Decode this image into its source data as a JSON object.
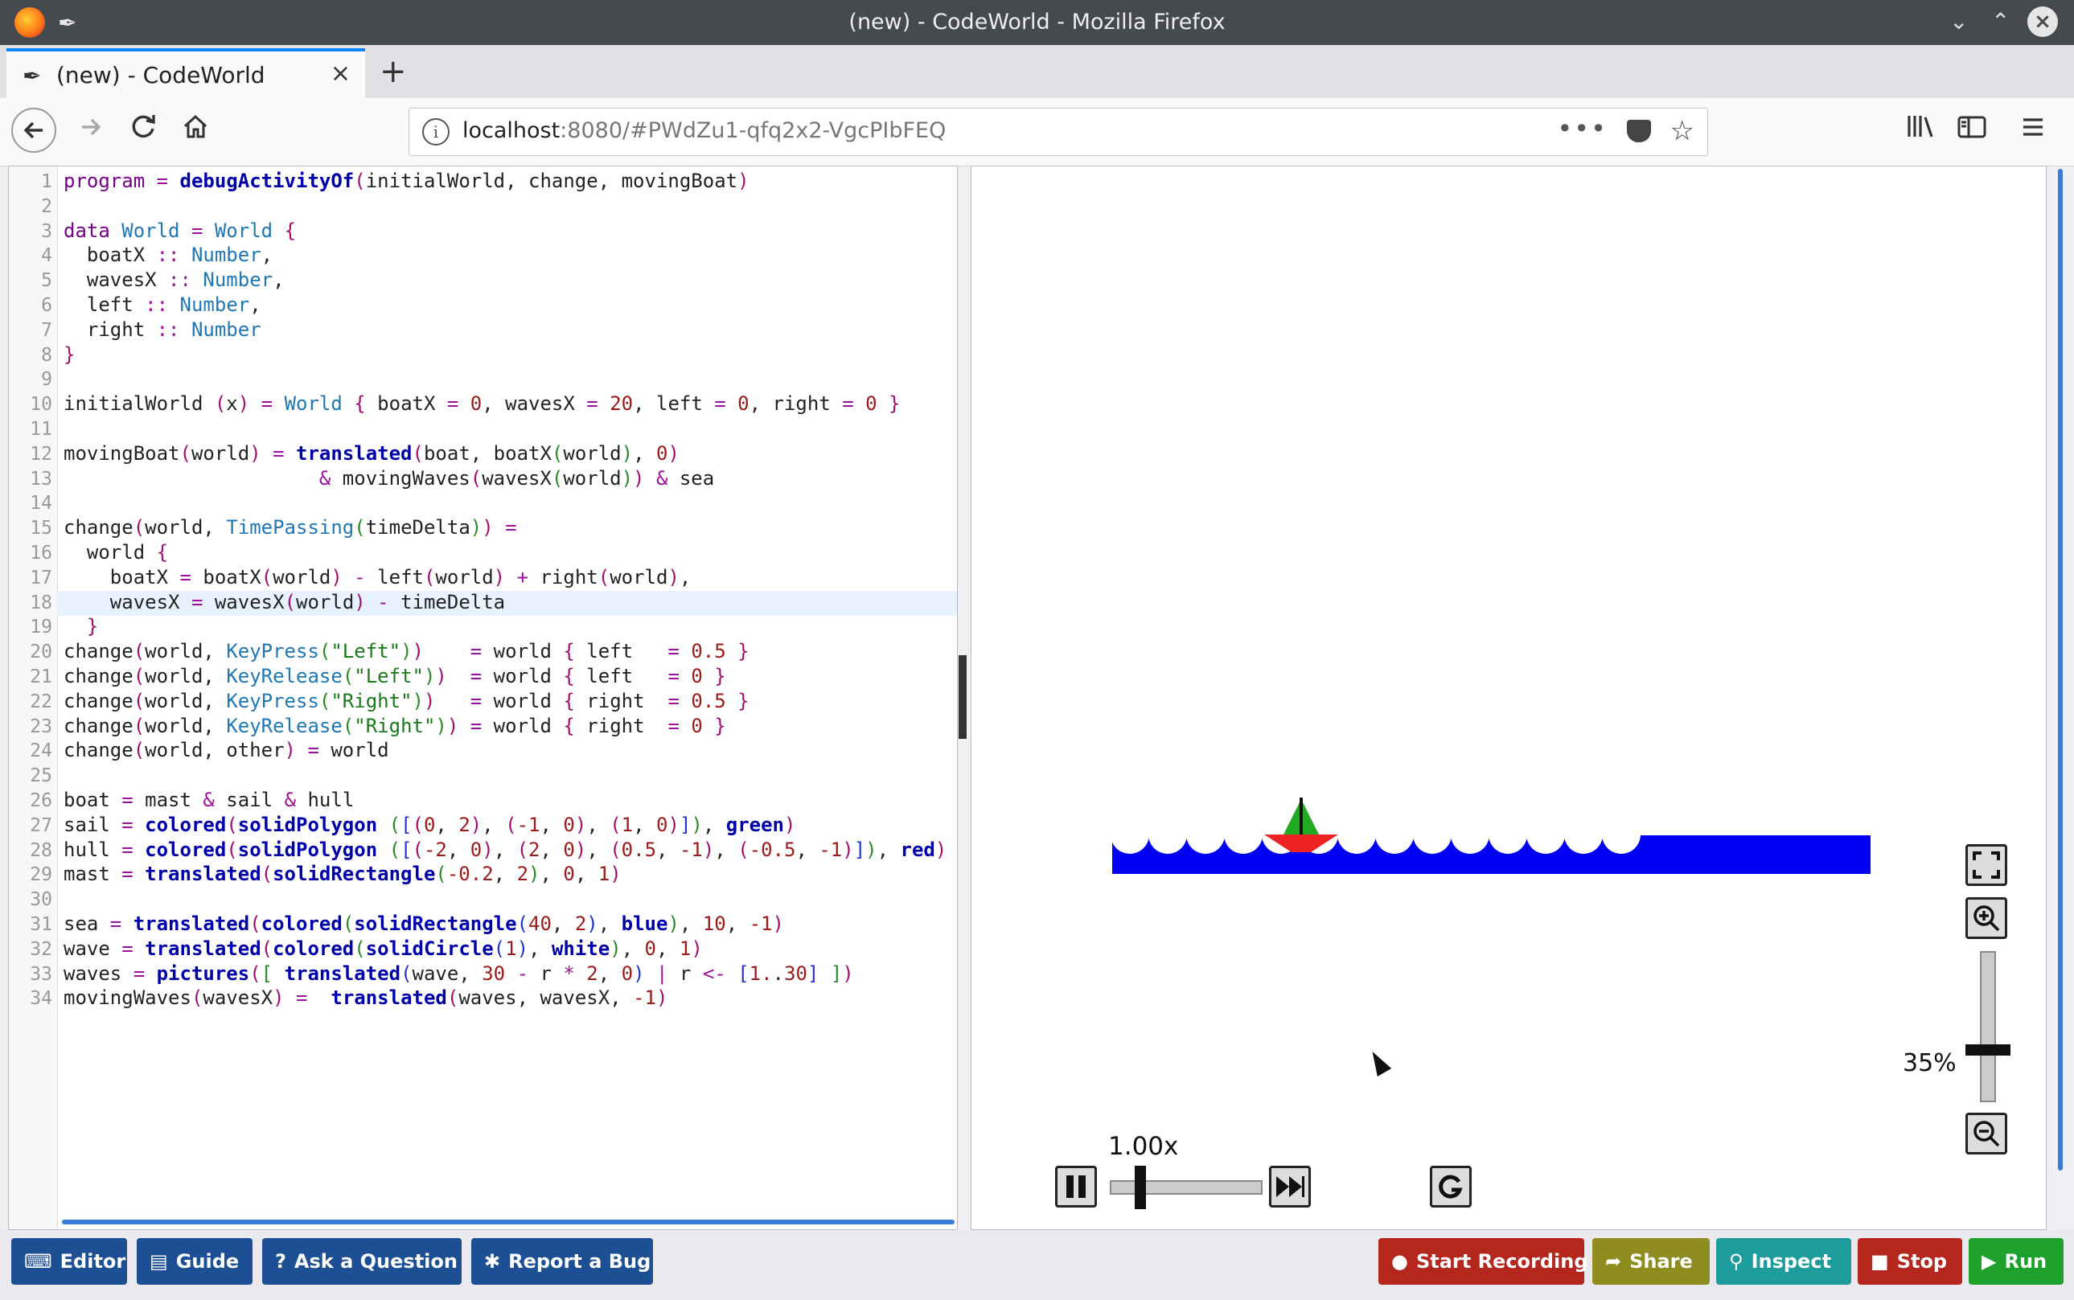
{
  "window": {
    "title": "(new) - CodeWorld - Mozilla Firefox"
  },
  "tab": {
    "label": "(new) - CodeWorld",
    "close": "×",
    "new_tab": "+"
  },
  "nav": {
    "url_host": "localhost",
    "url_rest": ":8080/#PWdZu1-qfq2x2-VgcPIbFEQ",
    "page_actions": "•••"
  },
  "editor": {
    "lines": [
      "program = debugActivityOf(initialWorld, change, movingBoat)",
      "",
      "data World = World {",
      "  boatX :: Number,",
      "  wavesX :: Number,",
      "  left :: Number,",
      "  right :: Number",
      "}",
      "",
      "initialWorld (x) = World { boatX = 0, wavesX = 20, left = 0, right = 0 }",
      "",
      "movingBoat(world) = translated(boat, boatX(world), 0)",
      "                      & movingWaves(wavesX(world)) & sea",
      "",
      "change(world, TimePassing(timeDelta)) =",
      "  world {",
      "    boatX = boatX(world) - left(world) + right(world),",
      "    wavesX = wavesX(world) - timeDelta",
      "  }",
      "change(world, KeyPress(\"Left\"))    = world { left   = 0.5 }",
      "change(world, KeyRelease(\"Left\"))  = world { left   = 0 }",
      "change(world, KeyPress(\"Right\"))   = world { right  = 0.5 }",
      "change(world, KeyRelease(\"Right\")) = world { right  = 0 }",
      "change(world, other) = world",
      "",
      "boat = mast & sail & hull",
      "sail = colored(solidPolygon ([(0, 2), (-1, 0), (1, 0)]), green)",
      "hull = colored(solidPolygon ([(-2, 0), (2, 0), (0.5, -1), (-0.5, -1)]), red)",
      "mast = translated(solidRectangle(-0.2, 2), 0, 1)",
      "",
      "sea = translated(colored(solidRectangle(40, 2), blue), 10, -1)",
      "wave = translated(colored(solidCircle(1), white), 0, 1)",
      "waves = pictures([ translated(wave, 30 - r * 2, 0) | r <- [1..30] ])",
      "movingWaves(wavesX) =  translated(waves, wavesX, -1)"
    ],
    "active_line": 18
  },
  "canvas": {
    "speed_label": "1.00x",
    "zoom_label": "35%",
    "speed_fraction": 0.12,
    "zoom_fraction": 0.35,
    "colors": {
      "sea": "#0000f5",
      "sail": "#22aa22",
      "hull": "#ee2222",
      "mast": "#111111"
    }
  },
  "bottombar": {
    "left": [
      {
        "label": "Editor",
        "icon": "keyboard-icon"
      },
      {
        "label": "Guide",
        "icon": "book-icon"
      },
      {
        "label": "Ask a Question",
        "icon": "question-icon"
      },
      {
        "label": "Report a Bug",
        "icon": "bug-icon"
      }
    ],
    "right": [
      {
        "label": "Start Recording",
        "icon": "record-icon",
        "color": "#b5261d"
      },
      {
        "label": "Share",
        "icon": "share-icon",
        "color": "#8f8d1f"
      },
      {
        "label": "Inspect",
        "icon": "search-icon",
        "color": "#1e9c9c"
      },
      {
        "label": "Stop",
        "icon": "stop-icon",
        "color": "#b5261d"
      },
      {
        "label": "Run",
        "icon": "play-icon",
        "color": "#1fa12e"
      }
    ]
  }
}
